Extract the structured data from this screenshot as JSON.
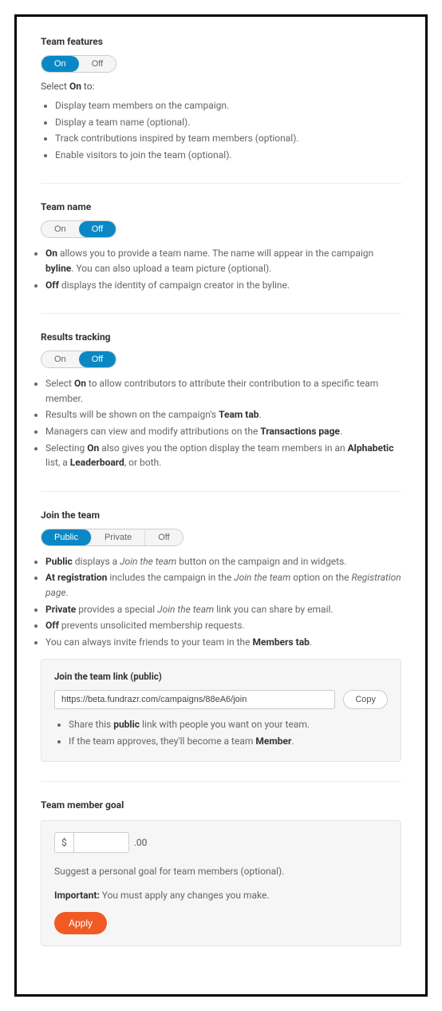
{
  "team_features": {
    "title": "Team features",
    "toggle": {
      "on": "On",
      "off": "Off",
      "active": "on"
    },
    "select_prefix": "Select ",
    "select_bold": "On",
    "select_suffix": " to:",
    "bullets": [
      "Display team members on the campaign.",
      "Display a team name (optional).",
      "Track contributions inspired by team members (optional).",
      "Enable visitors to join the team (optional)."
    ]
  },
  "team_name": {
    "title": "Team name",
    "toggle": {
      "on": "On",
      "off": "Off",
      "active": "off"
    },
    "b1_bold": "On",
    "b1_a": " allows you to provide a team name. The name will appear in the campaign ",
    "b1_bold2": "byline",
    "b1_b": ". You can also upload a team picture (optional).",
    "b2_bold": "Off",
    "b2_a": " displays the identity of campaign creator in the byline."
  },
  "results": {
    "title": "Results tracking",
    "toggle": {
      "on": "On",
      "off": "Off",
      "active": "off"
    },
    "b1_pre": "Select ",
    "b1_bold": "On",
    "b1_post": " to allow contributors to attribute their contribution to a specific team member.",
    "b2_pre": "Results will be shown on the campaign's ",
    "b2_bold": "Team tab",
    "b2_post": ".",
    "b3_pre": "Managers can view and modify attributions on the ",
    "b3_bold": "Transactions page",
    "b3_post": ".",
    "b4_pre": "Selecting ",
    "b4_bold1": "On",
    "b4_mid": " also gives you the option display the team members in an ",
    "b4_bold2": "Alphabetic",
    "b4_mid2": " list, a ",
    "b4_bold3": "Leaderboard",
    "b4_post": ", or both."
  },
  "join": {
    "title": "Join the team",
    "toggle": {
      "public": "Public",
      "private": "Private",
      "off": "Off",
      "active": "public"
    },
    "b1_bold": "Public",
    "b1_a": " displays a ",
    "b1_it": "Join the team",
    "b1_b": " button on the campaign and in widgets.",
    "b2_bold": "At registration",
    "b2_a": " includes the campaign in the ",
    "b2_it": "Join the team",
    "b2_b": " option on the ",
    "b2_it2": "Registration page",
    "b2_c": ".",
    "b3_bold": "Private",
    "b3_a": " provides a special ",
    "b3_it": "Join the team",
    "b3_b": " link you can share by email.",
    "b4_bold": "Off",
    "b4_a": " prevents unsolicited membership requests.",
    "b5_a": "You can always invite friends to your team in the ",
    "b5_bold": "Members tab",
    "b5_b": ".",
    "panel": {
      "title": "Join the team link (public)",
      "link": "https://beta.fundrazr.com/campaigns/88eA6/join",
      "copy": "Copy",
      "n1_a": "Share this ",
      "n1_bold": "public",
      "n1_b": " link with people you want on your team.",
      "n2_a": "If the team approves, they'll become a team ",
      "n2_bold": "Member",
      "n2_b": "."
    }
  },
  "goal": {
    "title": "Team member goal",
    "currency": "$",
    "cents": ".00",
    "suggest": "Suggest a personal goal for team members (optional).",
    "important_bold": "Important:",
    "important_text": " You must apply any changes you make.",
    "apply": "Apply"
  }
}
